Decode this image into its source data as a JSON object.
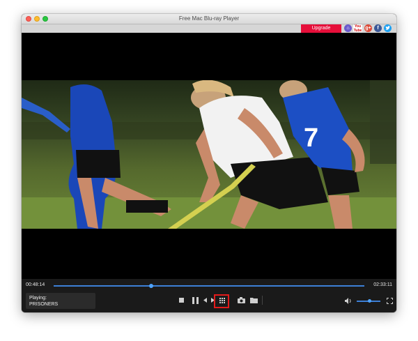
{
  "window": {
    "title": "Free Mac Blu-ray Player"
  },
  "header": {
    "upgrade_label": "Upgrade",
    "social_icons": [
      "home-icon",
      "youtube-icon",
      "google-plus-icon",
      "facebook-icon",
      "twitter-icon"
    ],
    "youtube_text": "You Tube",
    "google_plus_text": "g+",
    "facebook_text": "f"
  },
  "player": {
    "current_time": "00:48:14",
    "total_time": "02:33:11",
    "progress_fraction": 0.315,
    "volume_fraction": 0.55,
    "playing_label": "Playing:",
    "playing_title": "PRISONERS"
  },
  "colors": {
    "accent": "#3d7fd6",
    "upgrade": "#e60f3a",
    "highlight": "#e21b1b"
  }
}
